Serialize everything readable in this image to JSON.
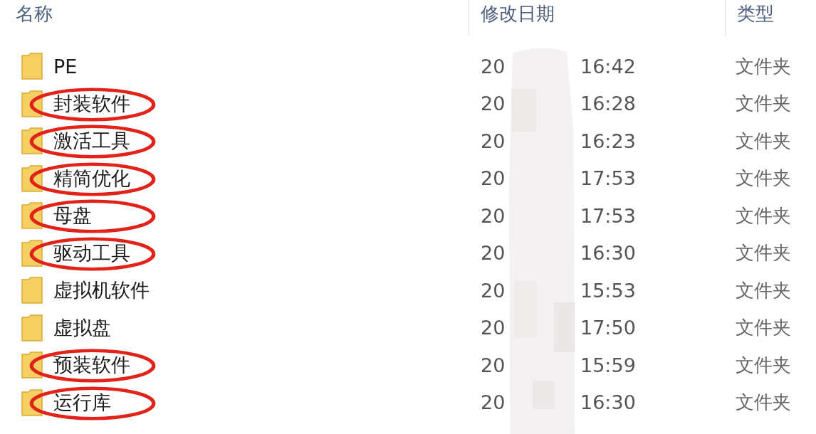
{
  "columns": [
    "名称",
    "修改日期",
    "类型"
  ],
  "rows": [
    {
      "name": "PE",
      "date": "20",
      "time": "16:42",
      "type": "文件夹",
      "circled": false
    },
    {
      "name": "封装软件",
      "date": "20",
      "time": "16:28",
      "type": "文件夹",
      "circled": true
    },
    {
      "name": "激活工具",
      "date": "20",
      "time": "16:23",
      "type": "文件夹",
      "circled": true
    },
    {
      "name": "精简优化",
      "date": "20",
      "time": "17:53",
      "type": "文件夹",
      "circled": true
    },
    {
      "name": "母盘",
      "date": "20",
      "time": "17:53",
      "type": "文件夹",
      "circled": true
    },
    {
      "name": "驱动工具",
      "date": "20",
      "time": "16:30",
      "type": "文件夹",
      "circled": true
    },
    {
      "name": "虚拟机软件",
      "date": "20",
      "time": "15:53",
      "type": "文件夹",
      "circled": false
    },
    {
      "name": "虚拟盘",
      "date": "20",
      "time": "17:50",
      "type": "文件夹",
      "circled": false
    },
    {
      "name": "预装软件",
      "date": "20",
      "time": "15:59",
      "type": "文件夹",
      "circled": true
    },
    {
      "name": "运行库",
      "date": "20",
      "time": "16:30",
      "type": "文件夹",
      "circled": true
    }
  ]
}
